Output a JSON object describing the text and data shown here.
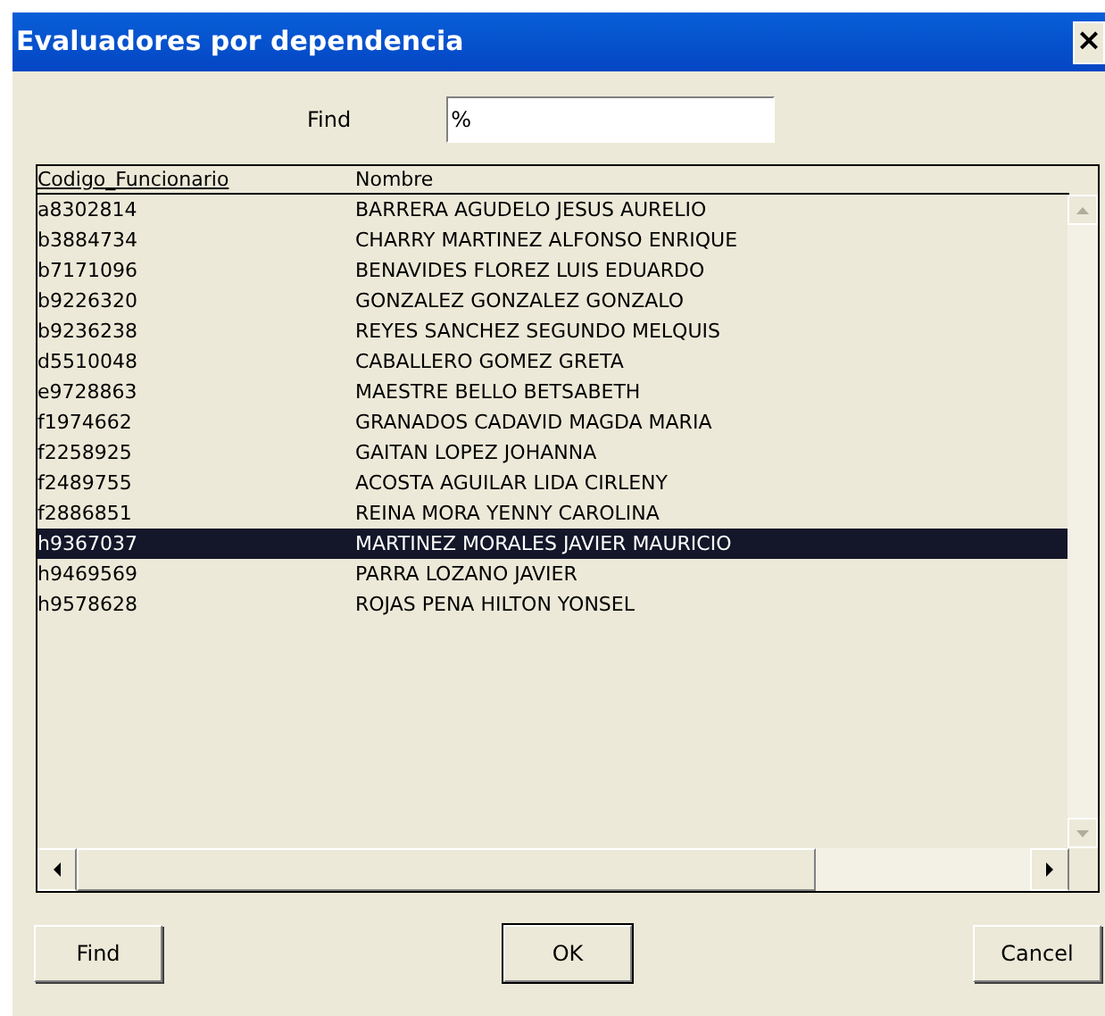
{
  "window": {
    "title": "Evaluadores por dependencia",
    "close": "×"
  },
  "find": {
    "label": "Find",
    "value": "%"
  },
  "table": {
    "columns": [
      "Codigo_Funcionario",
      "Nombre"
    ],
    "rows": [
      {
        "code": "a8302814",
        "name": "BARRERA AGUDELO JESUS AURELIO",
        "selected": false
      },
      {
        "code": "b3884734",
        "name": "CHARRY MARTINEZ ALFONSO ENRIQUE",
        "selected": false
      },
      {
        "code": "b7171096",
        "name": "BENAVIDES FLOREZ LUIS EDUARDO",
        "selected": false
      },
      {
        "code": "b9226320",
        "name": "GONZALEZ GONZALEZ GONZALO",
        "selected": false
      },
      {
        "code": "b9236238",
        "name": "REYES SANCHEZ SEGUNDO MELQUIS",
        "selected": false
      },
      {
        "code": "d5510048",
        "name": "CABALLERO GOMEZ GRETA",
        "selected": false
      },
      {
        "code": "e9728863",
        "name": "MAESTRE BELLO BETSABETH",
        "selected": false
      },
      {
        "code": "f1974662",
        "name": "GRANADOS CADAVID MAGDA MARIA",
        "selected": false
      },
      {
        "code": "f2258925",
        "name": "GAITAN LOPEZ JOHANNA",
        "selected": false
      },
      {
        "code": "f2489755",
        "name": "ACOSTA AGUILAR LIDA CIRLENY",
        "selected": false
      },
      {
        "code": "f2886851",
        "name": "REINA MORA YENNY CAROLINA",
        "selected": false
      },
      {
        "code": "h9367037",
        "name": "MARTINEZ MORALES JAVIER MAURICIO",
        "selected": true
      },
      {
        "code": "h9469569",
        "name": "PARRA LOZANO JAVIER",
        "selected": false
      },
      {
        "code": "h9578628",
        "name": "ROJAS PENA HILTON YONSEL",
        "selected": false
      }
    ]
  },
  "buttons": [
    "Find",
    "OK",
    "Cancel"
  ]
}
